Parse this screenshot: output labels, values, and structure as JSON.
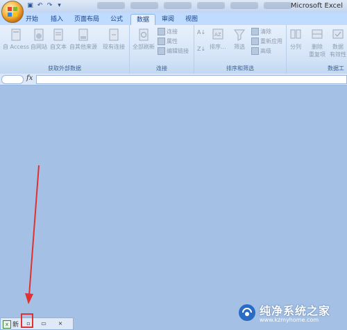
{
  "title_bar": {
    "app_title": "Microsoft Excel"
  },
  "tabs": [
    {
      "label": "开始"
    },
    {
      "label": "插入"
    },
    {
      "label": "页面布局"
    },
    {
      "label": "公式"
    },
    {
      "label": "数据",
      "active": true
    },
    {
      "label": "审阅"
    },
    {
      "label": "视图"
    }
  ],
  "ribbon": {
    "get_external": {
      "label": "获取外部数据",
      "access": "自 Access",
      "web": "自网站",
      "text": "自文本",
      "other": "自其他来源",
      "existing": "现有连接"
    },
    "connections": {
      "label": "连接",
      "refresh_all": "全部刷新",
      "connections": "连接",
      "properties": "属性",
      "edit_links": "编辑链接"
    },
    "sort_filter": {
      "label": "排序和筛选",
      "sort": "排序...",
      "filter": "筛选",
      "clear": "清除",
      "reapply": "重新应用",
      "advanced": "高级"
    },
    "data_tools": {
      "label": "数据工",
      "text_to_columns": "分列",
      "remove_dup_line1": "删除",
      "remove_dup_line2": "重复项",
      "validation_line1": "数据",
      "validation_line2": "有效性"
    }
  },
  "formula_bar": {
    "fx_label": "fx",
    "value": ""
  },
  "sheet_bar": {
    "new_label": "新",
    "controls": [
      "▫",
      "▫",
      "▭",
      "×"
    ]
  },
  "watermark": {
    "text": "纯净系统之家",
    "url": "www.kzmyhome.com"
  },
  "colors": {
    "workspace": "#a4c0e4",
    "accent": "#15428b",
    "annotation": "#e03030"
  }
}
